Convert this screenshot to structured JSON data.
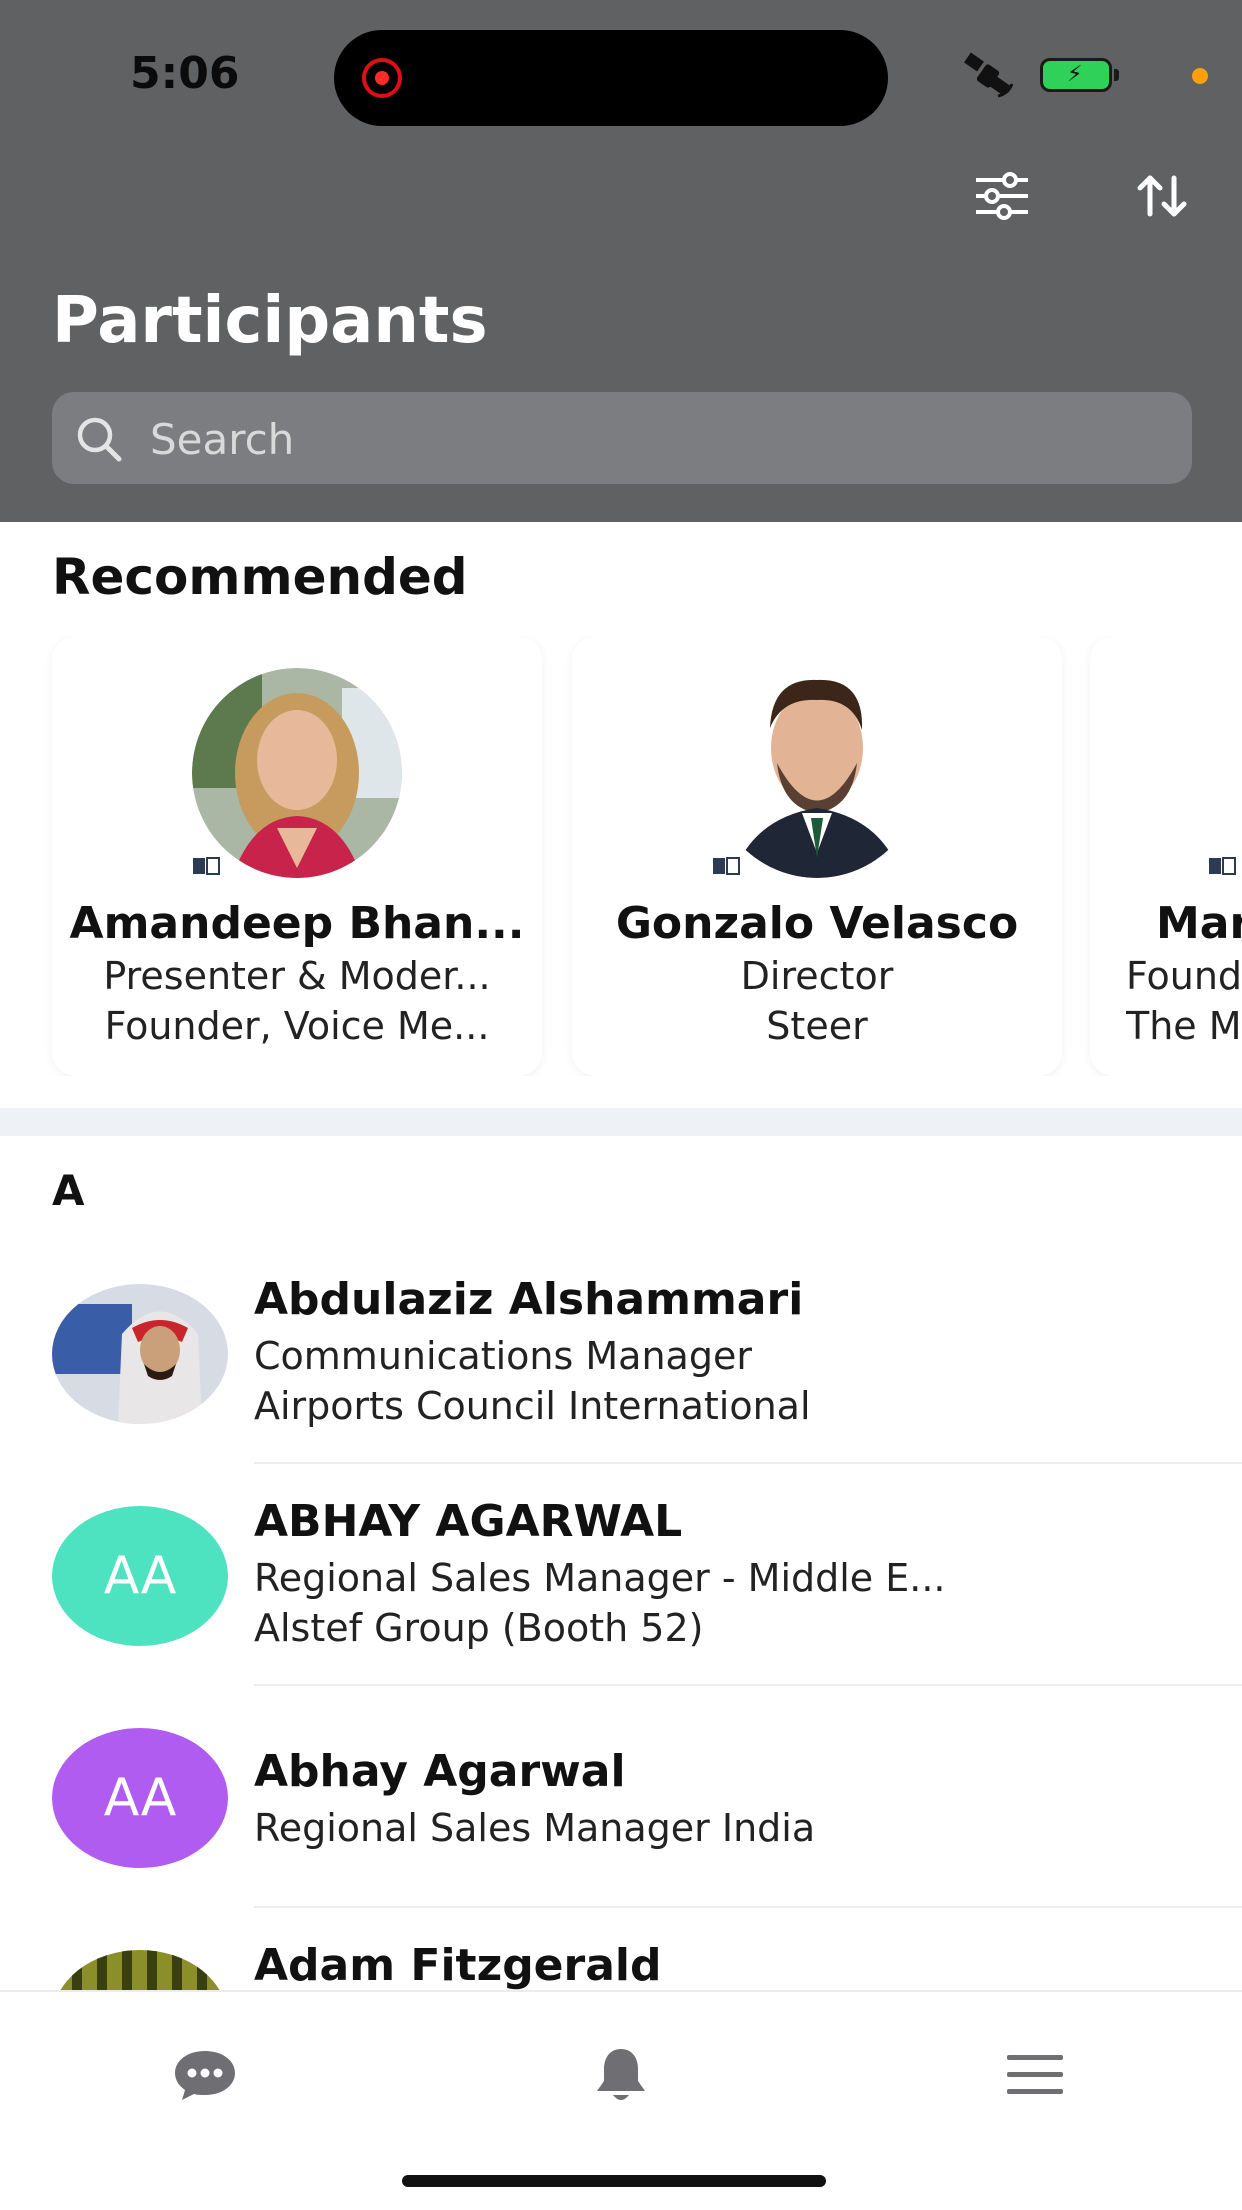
{
  "status_bar": {
    "time": "5:06",
    "icons": [
      "recording-icon",
      "satellite-icon",
      "battery-charging-icon",
      "privacy-dot"
    ]
  },
  "header": {
    "title": "Participants",
    "filter_icon": "sliders-icon",
    "sort_icon": "sort-arrows-icon",
    "search": {
      "placeholder": "Search",
      "value": ""
    },
    "background_color": "#5f6163"
  },
  "recommended": {
    "title": "Recommended",
    "cards": [
      {
        "name": "Amandeep Bhan...",
        "line1": "Presenter & Moder...",
        "line2": "Founder, Voice Me..."
      },
      {
        "name": "Gonzalo Velasco",
        "line1": "Director",
        "line2": "Steer"
      },
      {
        "name": "Mar",
        "line1": "Found",
        "line2": "The M"
      }
    ]
  },
  "participants": {
    "section_letter": "A",
    "rows": [
      {
        "name": "Abdulaziz Alshammari",
        "line1": "Communications Manager",
        "line2": "Airports Council International",
        "avatar": "photo"
      },
      {
        "name": "ABHAY AGARWAL",
        "line1": "Regional Sales Manager - Middle E...",
        "line2": "Alstef Group (Booth 52)",
        "initials": "AA",
        "avatar_color": "#4de3c0"
      },
      {
        "name": "Abhay Agarwal",
        "line1": "Regional Sales Manager India",
        "line2": "",
        "initials": "AA",
        "avatar_color": "#b15cf0"
      },
      {
        "name": "Adam Fitzgerald",
        "line1": "",
        "line2": "",
        "avatar": "photo"
      }
    ]
  },
  "tabbar": {
    "items": [
      "chat-icon",
      "bell-icon",
      "menu-icon"
    ],
    "icon_color": "#6f6f73"
  }
}
